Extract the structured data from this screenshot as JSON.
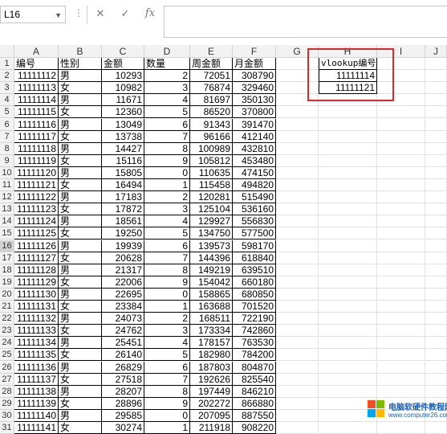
{
  "formula_bar": {
    "name_box": "L16",
    "cancel_icon": "close-icon",
    "confirm_icon": "check-icon",
    "fx_label": "fx",
    "formula": ""
  },
  "columns": [
    "A",
    "B",
    "C",
    "D",
    "E",
    "F",
    "G",
    "H",
    "I",
    "J"
  ],
  "active_row": 16,
  "headers": [
    "编号",
    "性别",
    "金额",
    "数量",
    "周金额",
    "月金额"
  ],
  "rows": [
    [
      "11111112",
      "男",
      "10293",
      "2",
      "72051",
      "308790"
    ],
    [
      "11111113",
      "女",
      "10982",
      "3",
      "76874",
      "329460"
    ],
    [
      "11111114",
      "男",
      "11671",
      "4",
      "81697",
      "350130"
    ],
    [
      "11111115",
      "女",
      "12360",
      "5",
      "86520",
      "370800"
    ],
    [
      "11111116",
      "男",
      "13049",
      "6",
      "91343",
      "391470"
    ],
    [
      "11111117",
      "女",
      "13738",
      "7",
      "96166",
      "412140"
    ],
    [
      "11111118",
      "男",
      "14427",
      "8",
      "100989",
      "432810"
    ],
    [
      "11111119",
      "女",
      "15116",
      "9",
      "105812",
      "453480"
    ],
    [
      "11111120",
      "男",
      "15805",
      "0",
      "110635",
      "474150"
    ],
    [
      "11111121",
      "女",
      "16494",
      "1",
      "115458",
      "494820"
    ],
    [
      "11111122",
      "男",
      "17183",
      "2",
      "120281",
      "515490"
    ],
    [
      "11111123",
      "女",
      "17872",
      "3",
      "125104",
      "536160"
    ],
    [
      "11111124",
      "男",
      "18561",
      "4",
      "129927",
      "556830"
    ],
    [
      "11111125",
      "女",
      "19250",
      "5",
      "134750",
      "577500"
    ],
    [
      "11111126",
      "男",
      "19939",
      "6",
      "139573",
      "598170"
    ],
    [
      "11111127",
      "女",
      "20628",
      "7",
      "144396",
      "618840"
    ],
    [
      "11111128",
      "男",
      "21317",
      "8",
      "149219",
      "639510"
    ],
    [
      "11111129",
      "女",
      "22006",
      "9",
      "154042",
      "660180"
    ],
    [
      "11111130",
      "男",
      "22695",
      "0",
      "158865",
      "680850"
    ],
    [
      "11111131",
      "女",
      "23384",
      "1",
      "163688",
      "701520"
    ],
    [
      "11111132",
      "男",
      "24073",
      "2",
      "168511",
      "722190"
    ],
    [
      "11111133",
      "女",
      "24762",
      "3",
      "173334",
      "742860"
    ],
    [
      "11111134",
      "男",
      "25451",
      "4",
      "178157",
      "763530"
    ],
    [
      "11111135",
      "女",
      "26140",
      "5",
      "182980",
      "784200"
    ],
    [
      "11111136",
      "男",
      "26829",
      "6",
      "187803",
      "804870"
    ],
    [
      "11111137",
      "女",
      "27518",
      "7",
      "192626",
      "825540"
    ],
    [
      "11111138",
      "男",
      "28207",
      "8",
      "197449",
      "846210"
    ],
    [
      "11111139",
      "女",
      "28896",
      "9",
      "202272",
      "866880"
    ],
    [
      "11111140",
      "男",
      "29585",
      "0",
      "207095",
      "887550"
    ],
    [
      "11111141",
      "女",
      "30274",
      "1",
      "211918",
      "908220"
    ]
  ],
  "lookup": {
    "header": "vlookup编号",
    "values": [
      "11111114",
      "11111121"
    ]
  },
  "watermark": {
    "line1": "电脑软硬件教程网",
    "line2": "www.computer26.com",
    "icon": "windows-logo-icon"
  },
  "colors": {
    "highlight_border": "#e0262b"
  }
}
